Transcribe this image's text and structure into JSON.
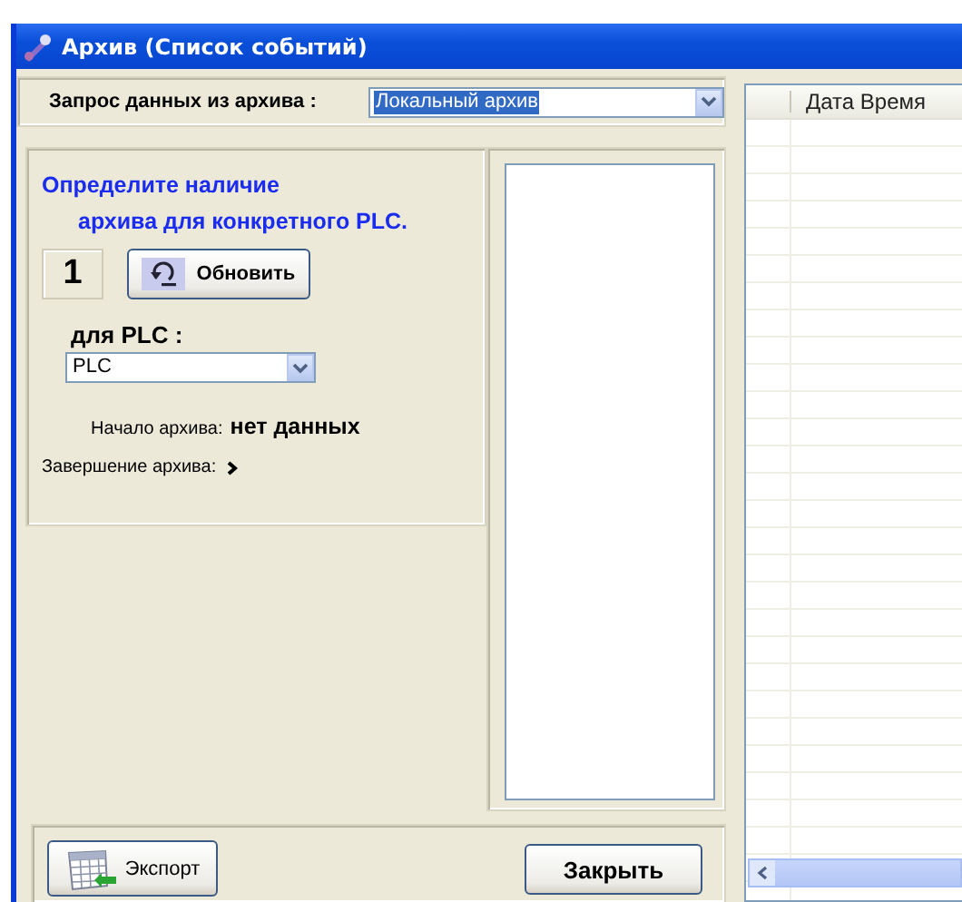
{
  "window": {
    "title": "Архив (Список событий)"
  },
  "query": {
    "label": "Запрос данных из архива :",
    "value": "Локальный архив",
    "highlighted": true
  },
  "plc_panel": {
    "heading_line1": "Определите наличие",
    "heading_line2": "архива для конкретного PLC.",
    "number": "1",
    "refresh_button": "Обновить",
    "plc_label": "для PLC :",
    "plc_value": "PLC",
    "start_label": "Начало архива:",
    "start_value": "нет данных",
    "end_label": "Завершение архива:"
  },
  "grid": {
    "columns": [
      "Дата Время"
    ]
  },
  "buttons": {
    "export": "Экспорт",
    "close": "Закрыть"
  }
}
